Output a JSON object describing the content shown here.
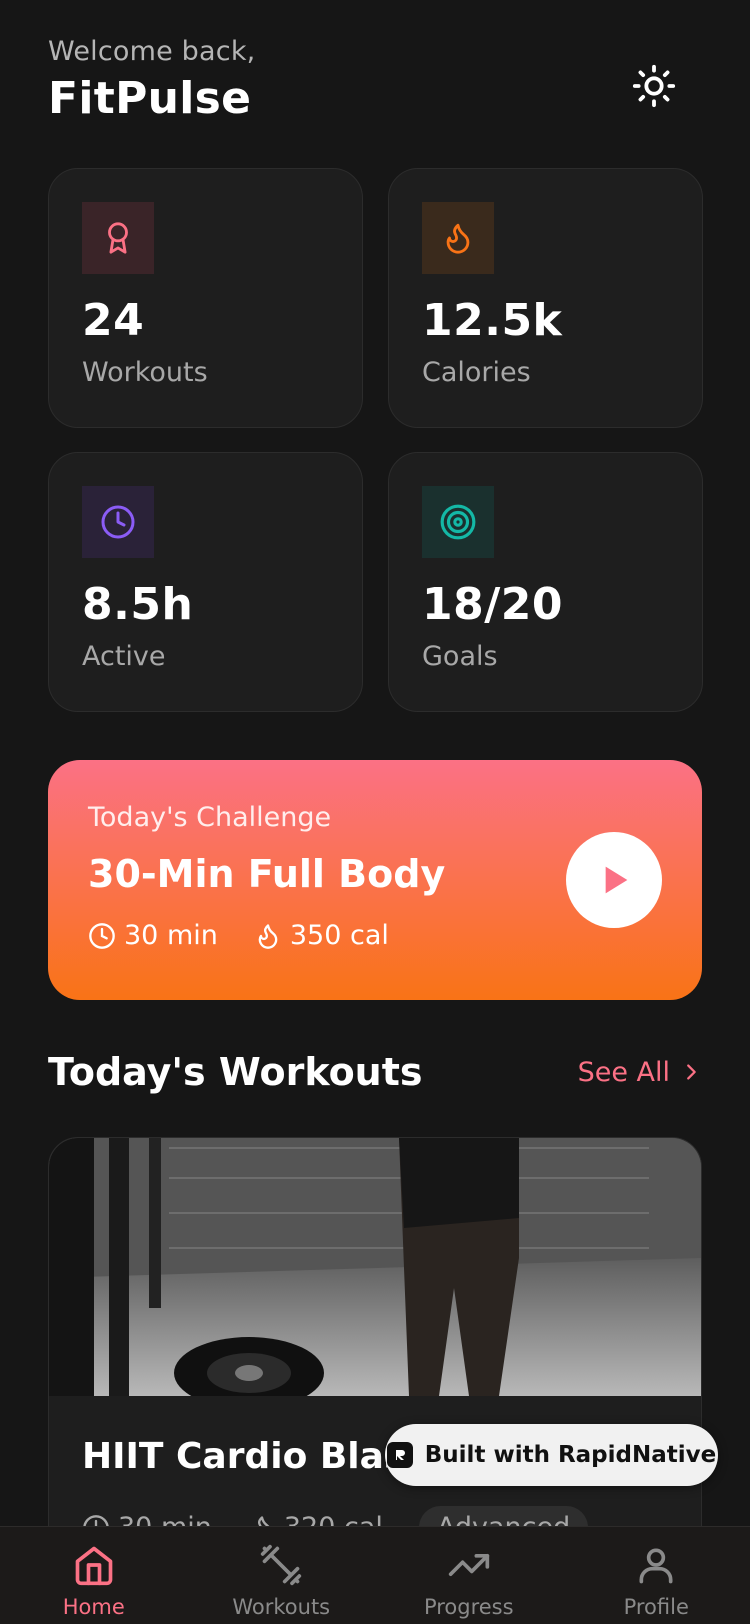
{
  "header": {
    "welcome": "Welcome back,",
    "title": "FitPulse"
  },
  "stats": [
    {
      "value": "24",
      "label": "Workouts",
      "icon": "award-icon",
      "color": "#fb7185"
    },
    {
      "value": "12.5k",
      "label": "Calories",
      "icon": "flame-icon",
      "color": "#f97316"
    },
    {
      "value": "8.5h",
      "label": "Active",
      "icon": "clock-icon",
      "color": "#8b5cf6"
    },
    {
      "value": "18/20",
      "label": "Goals",
      "icon": "target-icon",
      "color": "#14b8a6"
    }
  ],
  "challenge": {
    "subtitle": "Today's Challenge",
    "title": "30-Min Full Body",
    "duration": "30 min",
    "calories": "350 cal"
  },
  "workouts_section": {
    "title": "Today's Workouts",
    "see_all": "See All"
  },
  "workout": {
    "name": "HIIT Cardio Blast",
    "duration": "30 min",
    "calories": "320 cal",
    "level": "Advanced"
  },
  "badge": {
    "text": "Built with RapidNative"
  },
  "tabs": [
    {
      "label": "Home",
      "icon": "home-icon",
      "active": true
    },
    {
      "label": "Workouts",
      "icon": "dumbbell-icon",
      "active": false
    },
    {
      "label": "Progress",
      "icon": "trending-up-icon",
      "active": false
    },
    {
      "label": "Profile",
      "icon": "user-icon",
      "active": false
    }
  ],
  "colors": {
    "accent": "#fb7185",
    "orange": "#f97316",
    "background": "#161616",
    "card": "#1e1e1e"
  }
}
